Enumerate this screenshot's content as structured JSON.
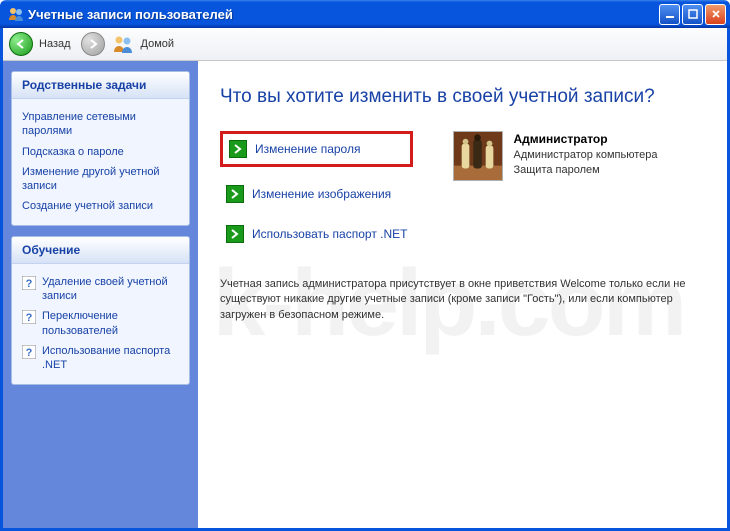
{
  "window": {
    "title": "Учетные записи пользователей"
  },
  "toolbar": {
    "back_label": "Назад",
    "home_label": "Домой"
  },
  "sidebar": {
    "related": {
      "header": "Родственные задачи",
      "items": [
        "Управление сетевыми паролями",
        "Подсказка о пароле",
        "Изменение другой учетной записи",
        "Создание учетной записи"
      ]
    },
    "learn": {
      "header": "Обучение",
      "items": [
        "Удаление своей учетной записи",
        "Переключение пользователей",
        "Использование паспорта .NET"
      ]
    }
  },
  "main": {
    "title": "Что вы хотите изменить в своей учетной записи?",
    "tasks": [
      "Изменение пароля",
      "Изменение изображения",
      "Использовать паспорт .NET"
    ],
    "user": {
      "name": "Администратор",
      "role": "Администратор компьютера",
      "protection": "Защита паролем"
    },
    "note": "Учетная запись администратора присутствует в окне приветствия Welcome только если не существуют никакие другие учетные записи (кроме записи \"Гость\"), или если компьютер загружен в безопасном режиме."
  },
  "watermark": "k-help.com"
}
